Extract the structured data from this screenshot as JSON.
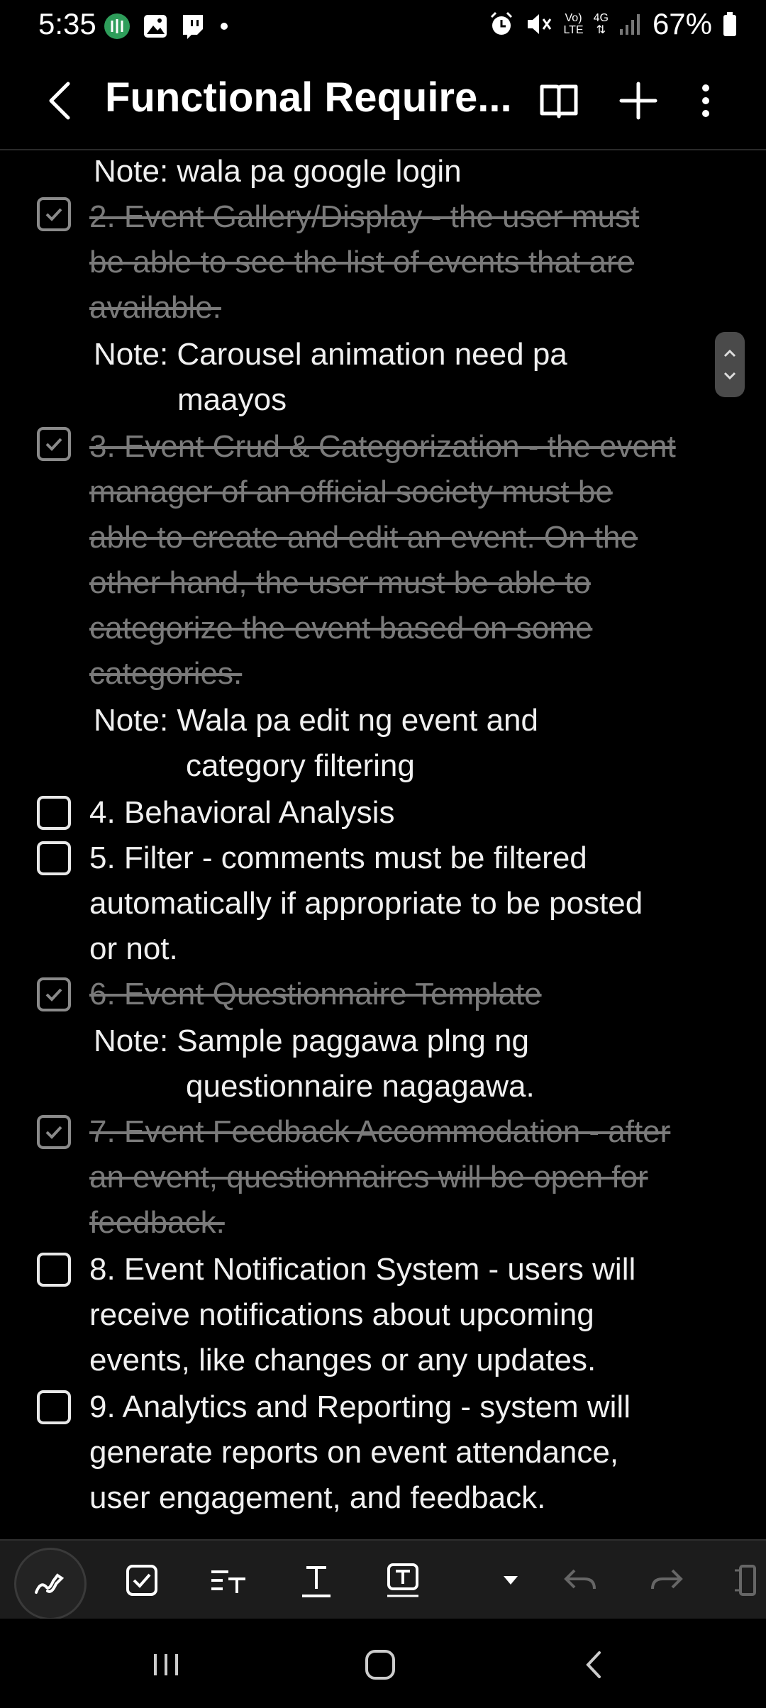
{
  "status_bar": {
    "time": "5:35",
    "battery": "67%",
    "network_label_1": "Vo)",
    "network_label_2": "LTE",
    "network_type": "4G",
    "left_icons": [
      "app-notification-icon",
      "gallery-icon",
      "twitch-icon",
      "dot-icon"
    ],
    "right_icons": [
      "alarm-icon",
      "mute-icon",
      "signal-icon",
      "battery-icon"
    ]
  },
  "app_bar": {
    "title": "Functional Require..."
  },
  "notes": {
    "note1": "Note: wala pa google login",
    "item2": [
      "2. Event Gallery/Display - the user must",
      "be able to see the list of events that are",
      "available."
    ],
    "note2": [
      "Note: Carousel animation need pa",
      "maayos"
    ],
    "item3": [
      "3. Event Crud & Categorization - the event",
      "manager of an official society must be",
      "able to create and edit an event. On the",
      "other hand, the user must be able to",
      "categorize the event based on some",
      "categories."
    ],
    "note3": [
      "Note: Wala pa edit ng event and",
      "category filtering"
    ],
    "item4": [
      "4. Behavioral Analysis"
    ],
    "item5": [
      "5. Filter - comments must be filtered",
      "automatically if appropriate to be posted",
      "or not."
    ],
    "item6": [
      "6. Event Questionnaire Template"
    ],
    "note6": [
      "Note: Sample paggawa plng ng",
      "questionnaire nagagawa."
    ],
    "item7": [
      "7. Event Feedback Accommodation - after",
      "an event, questionnaires will be open for",
      "feedback."
    ],
    "item8": [
      "8. Event Notification System - users will",
      "receive notifications about upcoming",
      "events, like changes or any updates."
    ],
    "item9": [
      "9. Analytics and Reporting - system will",
      "generate reports on event attendance,",
      "user engagement, and feedback."
    ]
  },
  "checkbox_state": {
    "item2": true,
    "item3": true,
    "item4": false,
    "item5": false,
    "item6": true,
    "item7": true,
    "item8": false,
    "item9": false
  },
  "colors": {
    "background": "#000000",
    "text": "#f0f0f0",
    "done_text": "#7a7a7a",
    "toolbar": "#1c1c1c"
  }
}
